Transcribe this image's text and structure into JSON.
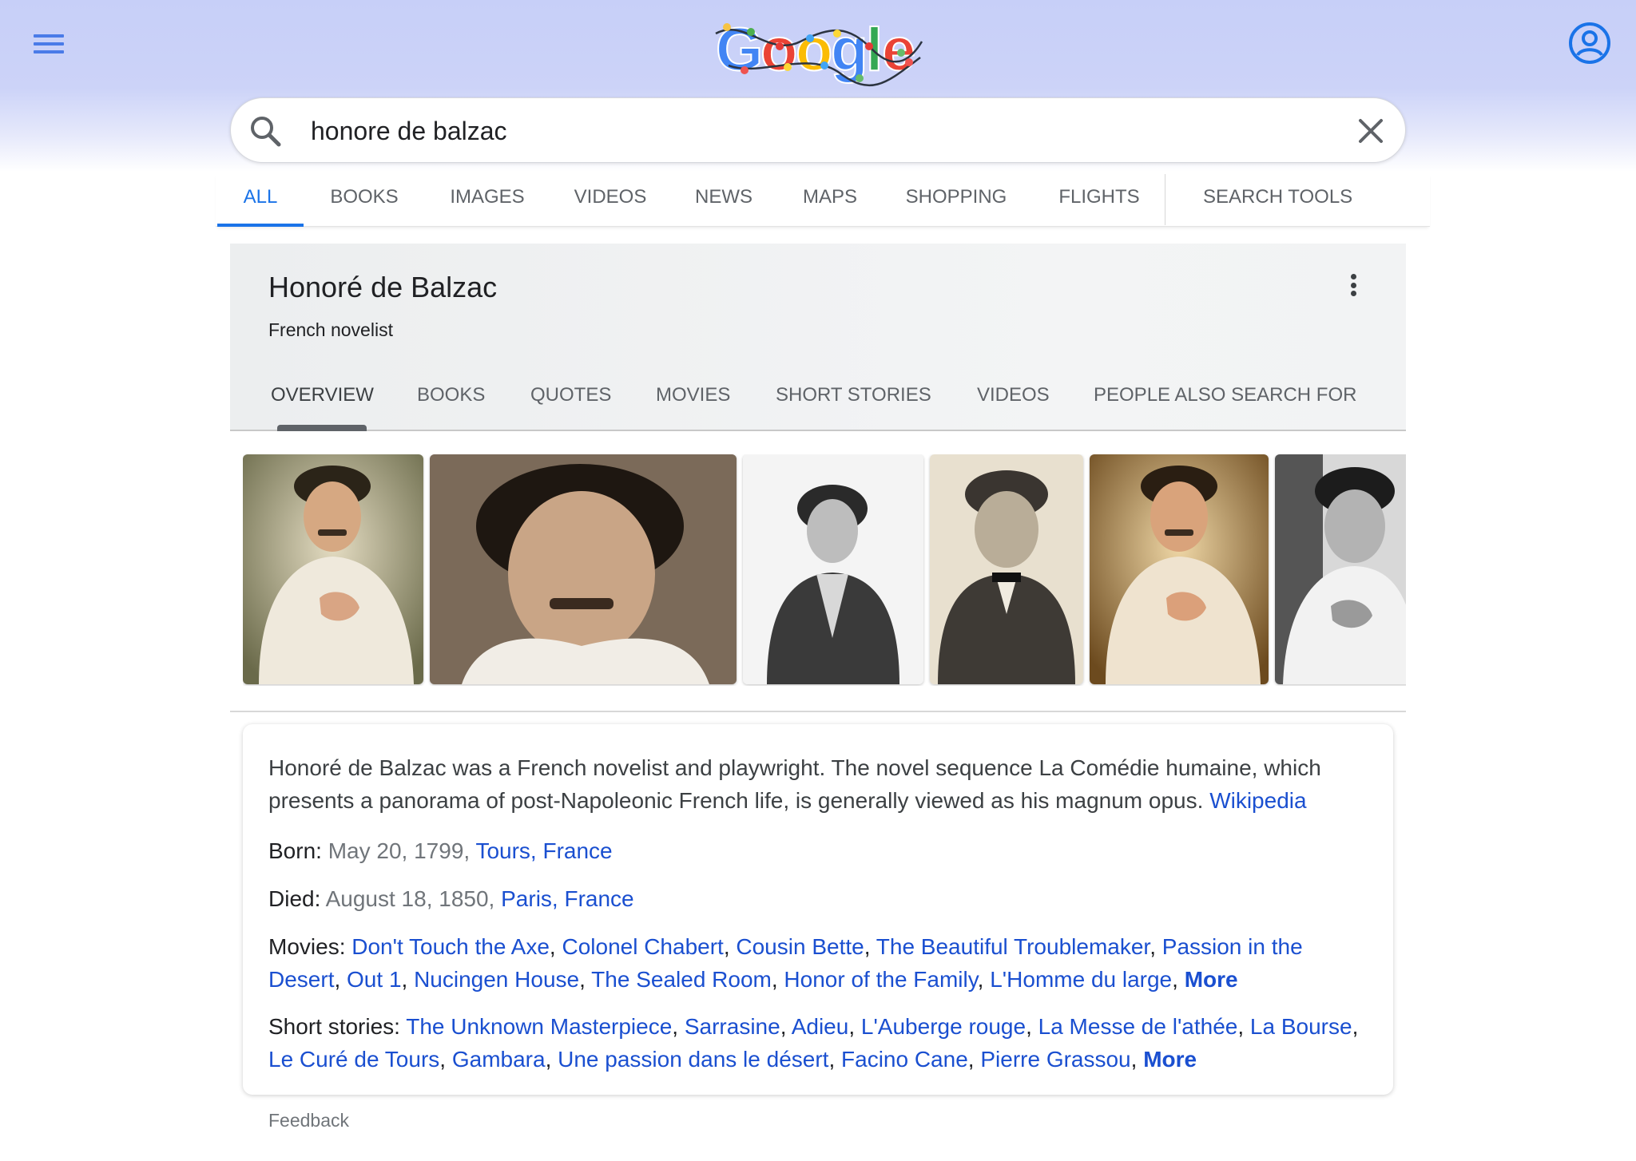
{
  "header": {
    "logo_text": "Google",
    "logo_colors": [
      "#4285f4",
      "#ea4335",
      "#fbbc05",
      "#4285f4",
      "#34a853",
      "#ea4335"
    ]
  },
  "search": {
    "value": "honore de balzac",
    "placeholder": ""
  },
  "tabs": [
    {
      "label": "ALL",
      "active": true
    },
    {
      "label": "BOOKS"
    },
    {
      "label": "IMAGES"
    },
    {
      "label": "VIDEOS"
    },
    {
      "label": "NEWS"
    },
    {
      "label": "MAPS"
    },
    {
      "label": "SHOPPING"
    },
    {
      "label": "FLIGHTS"
    },
    {
      "label": "SEARCH TOOLS"
    }
  ],
  "knowledge_panel": {
    "title": "Honoré de Balzac",
    "subtitle": "French novelist",
    "tabs": [
      {
        "label": "OVERVIEW",
        "active": true
      },
      {
        "label": "BOOKS"
      },
      {
        "label": "QUOTES"
      },
      {
        "label": "MOVIES"
      },
      {
        "label": "SHORT STORIES"
      },
      {
        "label": "VIDEOS"
      },
      {
        "label": "PEOPLE ALSO SEARCH FOR"
      }
    ],
    "description": "Honoré de Balzac was a French novelist and playwright. The novel sequence La Comédie humaine, which presents a panorama of post-Napoleonic French life, is generally viewed as his magnum opus.",
    "description_source": "Wikipedia",
    "born": {
      "label": "Born:",
      "date": "May 20, 1799,",
      "place": "Tours, France"
    },
    "died": {
      "label": "Died:",
      "date": "August 18, 1850,",
      "place": "Paris, France"
    },
    "movies": {
      "label": "Movies:",
      "items": [
        "Don't Touch the Axe",
        "Colonel Chabert",
        "Cousin Bette",
        "The Beautiful Troublemaker",
        "Passion in the Desert",
        "Out 1",
        "Nucingen House",
        "The Sealed Room",
        "Honor of the Family",
        "L'Homme du large"
      ],
      "more": "More"
    },
    "short_stories": {
      "label": "Short stories:",
      "items": [
        "The Unknown Masterpiece",
        "Sarrasine",
        "Adieu",
        "L'Auberge rouge",
        "La Messe de l'athée",
        "La Bourse",
        "Le Curé de Tours",
        "Gambara",
        "Une passion dans le désert",
        "Facino Cane",
        "Pierre Grassou"
      ],
      "more": "More"
    },
    "feedback": "Feedback"
  },
  "colors": {
    "accent": "#1a73e8",
    "link": "#1a4fd0",
    "header_bg": "#c7cff8"
  }
}
